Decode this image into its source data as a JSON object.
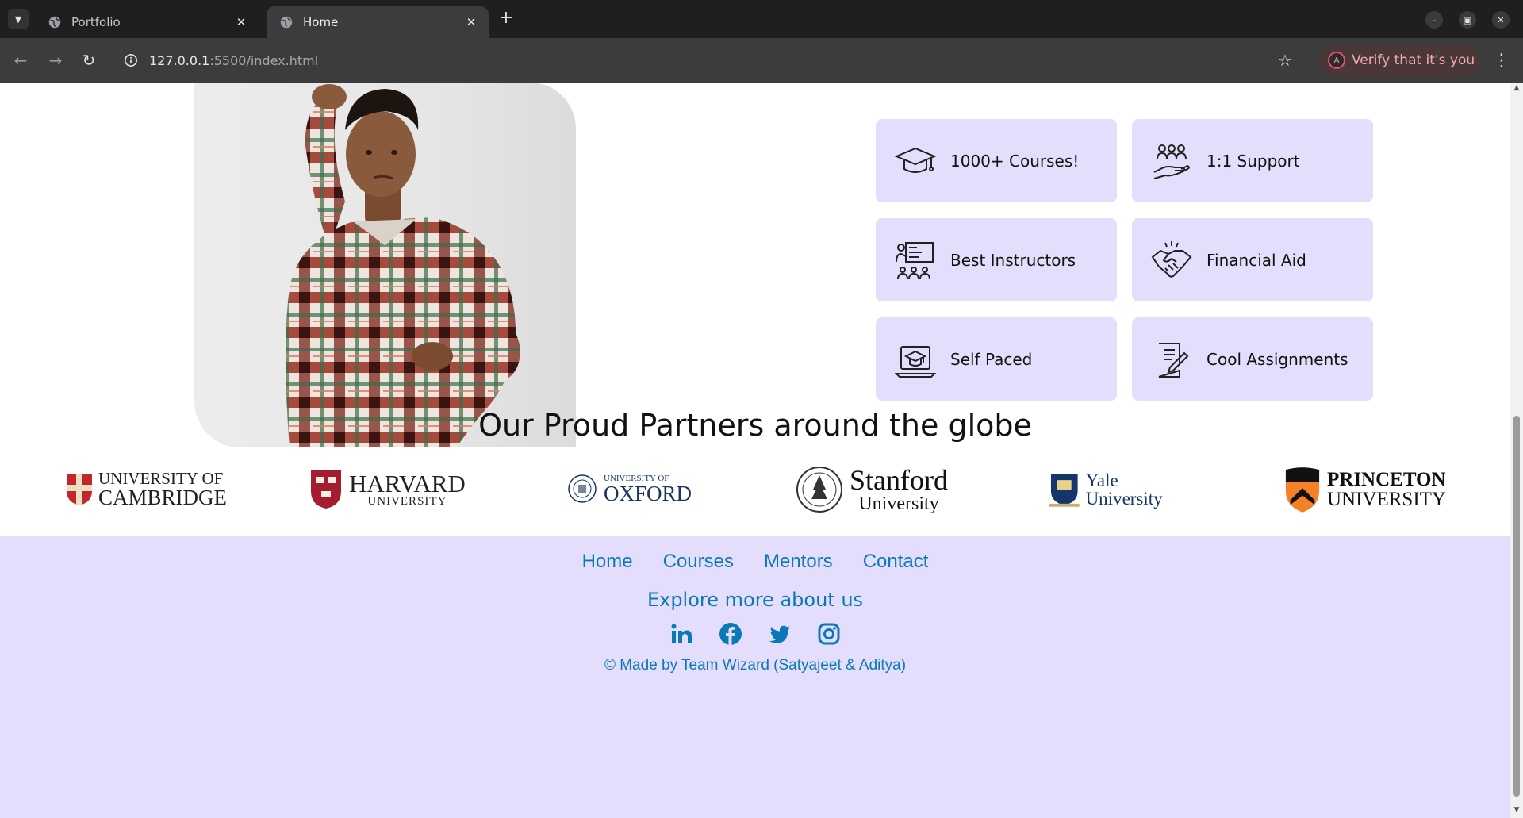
{
  "browser": {
    "tabs": [
      {
        "title": "Portfolio",
        "active": false
      },
      {
        "title": "Home",
        "active": true
      }
    ],
    "url_host": "127.0.0.1",
    "url_path": ":5500/index.html",
    "verify_label": "Verify that it's you",
    "avatar_letter": "A"
  },
  "features": [
    {
      "label": "1000+ Courses!",
      "icon": "graduation-cap-icon"
    },
    {
      "label": "1:1 Support",
      "icon": "support-hand-icon"
    },
    {
      "label": "Best Instructors",
      "icon": "instructor-icon"
    },
    {
      "label": "Financial Aid",
      "icon": "handshake-icon"
    },
    {
      "label": "Self Paced",
      "icon": "laptop-cap-icon"
    },
    {
      "label": "Cool Assignments",
      "icon": "assignment-icon"
    }
  ],
  "partners": {
    "title": "Our Proud Partners around the globe",
    "logos": [
      {
        "line1": "UNIVERSITY OF",
        "line2": "CAMBRIDGE"
      },
      {
        "line1": "HARVARD",
        "line2": "UNIVERSITY"
      },
      {
        "line1": "UNIVERSITY OF",
        "line2": "OXFORD"
      },
      {
        "line1": "Stanford",
        "line2": "University"
      },
      {
        "line1": "Yale University"
      },
      {
        "line1": "PRINCETON",
        "line2": "UNIVERSITY"
      }
    ]
  },
  "footer": {
    "nav": [
      "Home",
      "Courses",
      "Mentors",
      "Contact"
    ],
    "explore": "Explore more about us",
    "social": [
      "linkedin-icon",
      "facebook-icon",
      "twitter-icon",
      "instagram-icon"
    ],
    "copyright": "© Made by Team Wizard (Satyajeet & Aditya)"
  },
  "colors": {
    "card_bg": "#e4defc",
    "footer_bg": "#e4defc",
    "link": "#0a79b8",
    "chrome_dark": "#1f1f1f",
    "chrome_toolbar": "#3c3c3c"
  }
}
